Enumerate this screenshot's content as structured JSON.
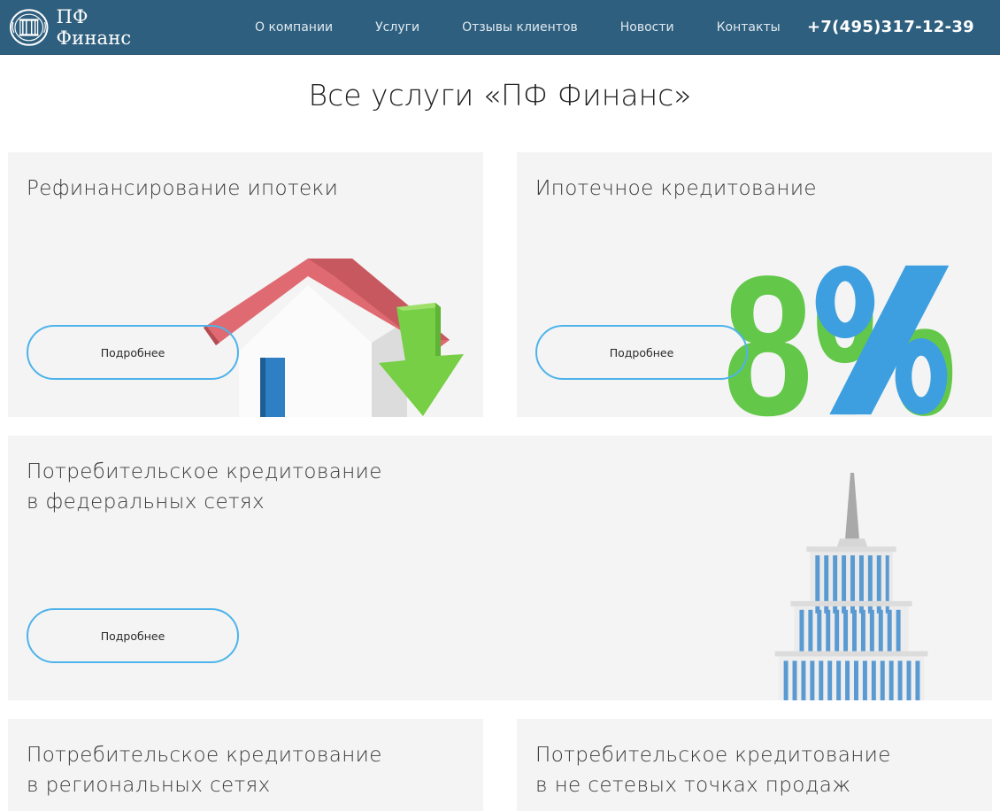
{
  "header": {
    "logo_text": "ПФ Финанс",
    "nav": [
      {
        "label": "О компании"
      },
      {
        "label": "Услуги"
      },
      {
        "label": "Отзывы клиентов"
      },
      {
        "label": "Новости"
      },
      {
        "label": "Контакты"
      }
    ],
    "phone": "+7(495)317-12-39"
  },
  "page": {
    "title": "Все услуги «ПФ Финанс»"
  },
  "services": [
    {
      "title_lines": [
        "Рефинансирование ипотеки"
      ],
      "button": "Подробнее"
    },
    {
      "title_lines": [
        "Ипотечное кредитование"
      ],
      "button": "Подробнее",
      "illustration_text": "8%"
    },
    {
      "title_lines": [
        "Потребительское кредитование",
        "в федеральных сетях"
      ],
      "button": "Подробнее"
    },
    {
      "title_lines": [
        "Потребительское кредитование",
        "в региональных сетях"
      ]
    },
    {
      "title_lines": [
        "Потребительское кредитование",
        "в не сетевых точках продаж"
      ]
    }
  ],
  "colors": {
    "header_bg": "#2f5f7e",
    "button_border": "#4db3ea",
    "card_bg": "#f4f4f4"
  },
  "icons": {
    "logo": "emblem-logo-icon",
    "card1": "house-with-down-arrow-icon",
    "card2": "eight-percent-icon",
    "card3": "skyscraper-icon"
  }
}
